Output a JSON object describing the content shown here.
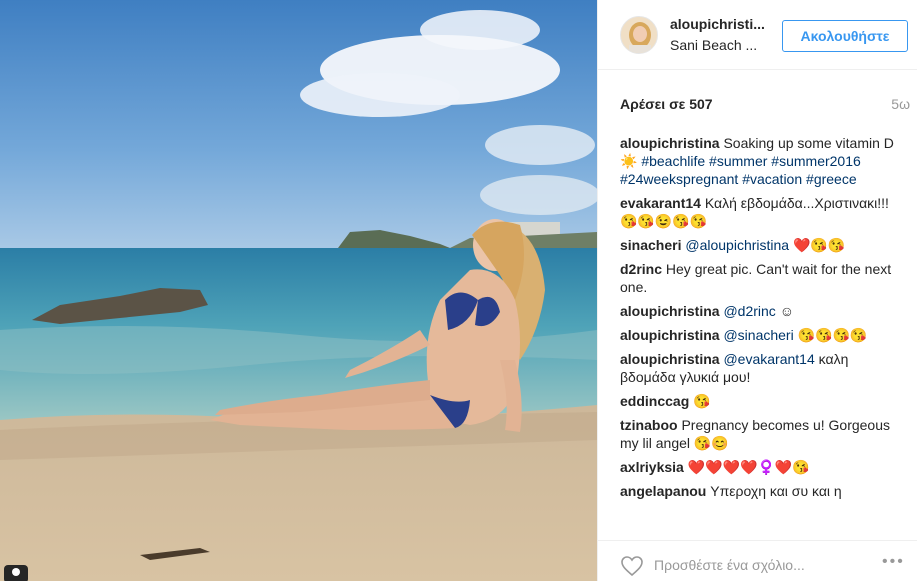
{
  "post": {
    "username": "aloupichristi...",
    "location": "Sani Beach ...",
    "follow_label": "Ακολουθήστε",
    "likes": "Αρέσει σε 507",
    "age": "5ω"
  },
  "caption": {
    "author": "aloupichristina",
    "text": "Soaking up some vitamin D ☀️ ",
    "tags": [
      "#beachlife",
      "#summer",
      "#summer2016",
      "#24weekspregnant",
      "#vacation",
      "#greece"
    ]
  },
  "comments": [
    {
      "author": "evakarant14",
      "text": "Καλή εβδομάδα...Χριστινακι!!!😘😘😉😘😘"
    },
    {
      "author": "sinacheri",
      "mention": "@aloupichristina",
      "text": " ❤️😘😘"
    },
    {
      "author": "d2rinc",
      "text": "Hey great pic. Can't wait for the next one."
    },
    {
      "author": "aloupichristina",
      "mention": "@d2rinc",
      "text": " ☺"
    },
    {
      "author": "aloupichristina",
      "mention": "@sinacheri",
      "text": " 😘😘😘😘"
    },
    {
      "author": "aloupichristina",
      "mention": "@evakarant14",
      "text": " καλη βδομάδα γλυκιά μου!"
    },
    {
      "author": "eddinccag",
      "text": "😘"
    },
    {
      "author": "tzinaboo",
      "text": "Pregnancy becomes u! Gorgeous my lil angel 😘😊"
    },
    {
      "author": "axlriyksia",
      "text": "❤️❤️❤️❤️♀️❤️😘"
    },
    {
      "author": "angelapanou",
      "text": "Υπεροχη και συ και η"
    }
  ],
  "footer": {
    "placeholder": "Προσθέστε ένα σχόλιο...",
    "heart_icon": "heart-icon",
    "more_icon": "more-options-icon",
    "more_label": "•••"
  },
  "colors": {
    "follow_blue": "#3897f0",
    "tag_blue": "#003569",
    "muted": "#999999"
  }
}
